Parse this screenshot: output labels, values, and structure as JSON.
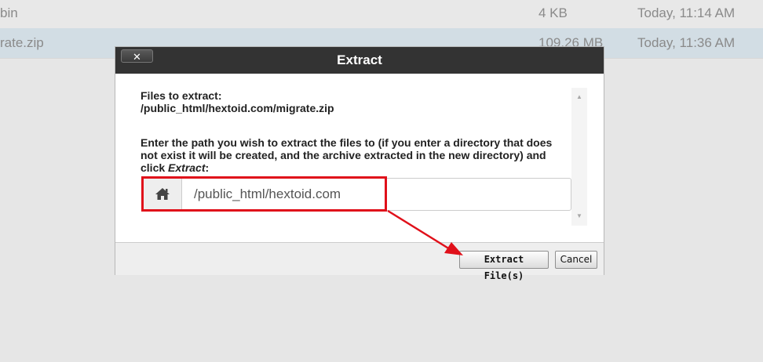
{
  "file_list": [
    {
      "name": "bin",
      "size": "4 KB",
      "modified": "Today, 11:14 AM"
    },
    {
      "name": "rate.zip",
      "size": "109.26 MB",
      "modified": "Today, 11:36 AM"
    }
  ],
  "dialog": {
    "title": "Extract",
    "close_label": "✕",
    "files_label": "Files to extract:",
    "file_path": "/public_html/hextoid.com/migrate.zip",
    "prompt_text": "Enter the path you wish to extract the files to (if you enter a directory that does not exist it will be created, and the archive extracted in the new directory) and click ",
    "prompt_emphasis": "Extract",
    "prompt_end": ":",
    "path_value": "/public_html/hextoid.com",
    "extract_button": "Extract File(s)",
    "cancel_button": "Cancel"
  },
  "icons": {
    "home": "home-icon",
    "close": "close-icon",
    "scroll_up": "scroll-up-icon",
    "scroll_down": "scroll-down-icon",
    "arrow": "annotation-arrow"
  },
  "colors": {
    "titlebar": "#333333",
    "highlight": "#e0101a",
    "selected_row": "#d2dde4"
  }
}
